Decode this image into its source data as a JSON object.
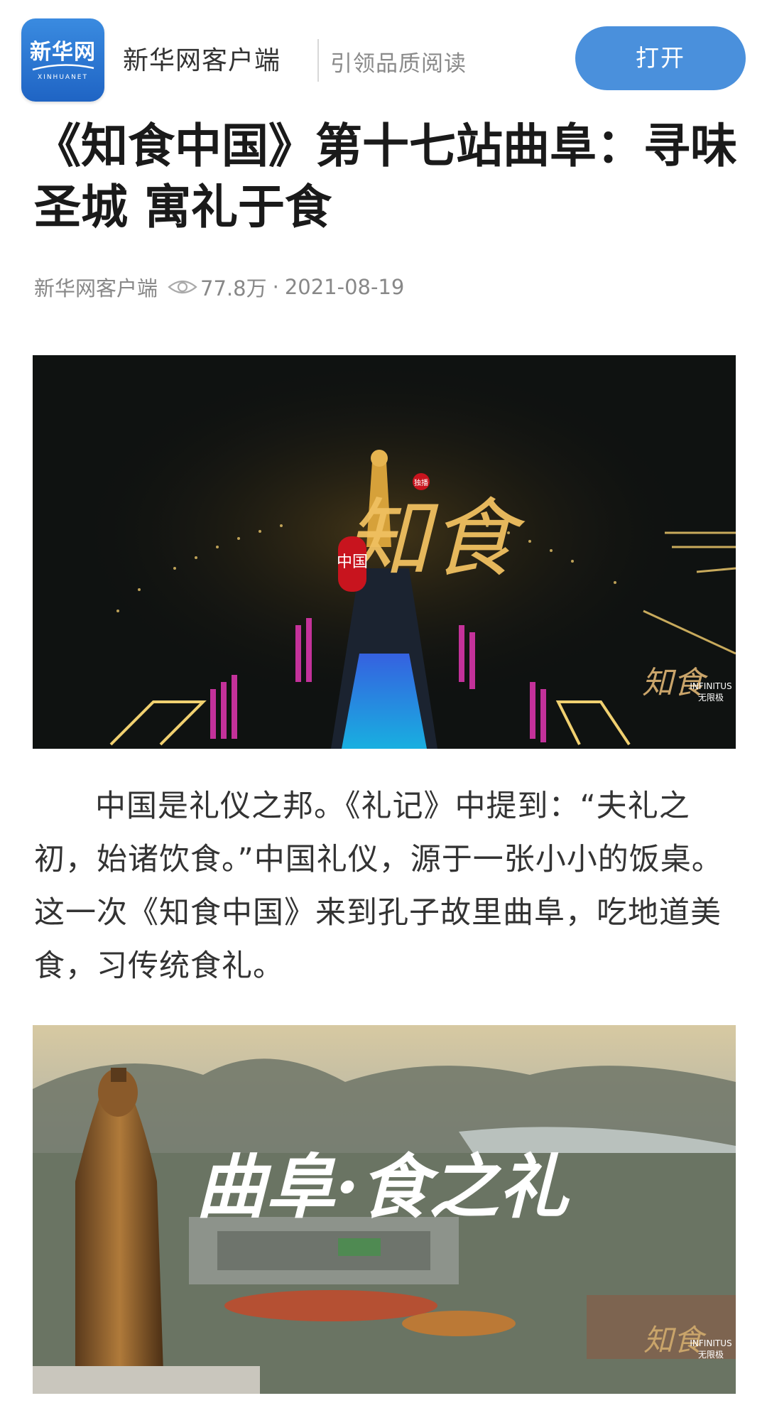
{
  "banner": {
    "logo_text": "新华网",
    "logo_subtext": "XINHUANET",
    "app_name": "新华网客户端",
    "slogan": "引领品质阅读",
    "open_button": "打开"
  },
  "article": {
    "title": "《知食中国》第十七站曲阜：寻味圣城 寓礼于食",
    "source": "新华网客户端",
    "views": "77.8万",
    "separator": "·",
    "date": "2021-08-19",
    "paragraph": "中国是礼仪之邦。《礼记》中提到：“夫礼之初，始诸饮食。”中国礼仪，源于一张小小的饭桌。这一次《知食中国》来到孔子故里曲阜，吃地道美食，习传统食礼。"
  },
  "images": {
    "image1": {
      "calligraphy": "知食",
      "seal": "中国",
      "badge": "独播",
      "watermark_brand": "INFINITUS",
      "watermark_cn": "无限极"
    },
    "image2": {
      "overlay_title": "曲阜·食之礼",
      "watermark_brand": "INFINITUS",
      "watermark_cn": "无限极"
    }
  },
  "colors": {
    "open_button": "#4a90dc",
    "logo": "#2a74d3"
  }
}
